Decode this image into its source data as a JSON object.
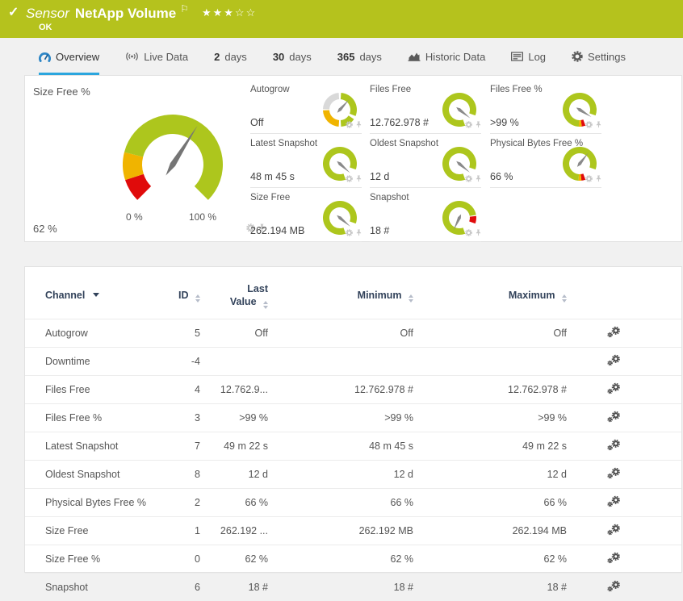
{
  "colors": {
    "green": "#adc61d",
    "yellow": "#f0b400",
    "red": "#e00b0b",
    "gray": "#d9d9d9",
    "header_green": "#b5c21d",
    "accent_blue": "#2ba6de",
    "navy": "#32425a",
    "needle": "#757575",
    "mini_needle": "#8a8a8a"
  },
  "header": {
    "kind_label": "Sensor",
    "title": "NetApp Volume",
    "status": "OK",
    "flag_icon": "flag-icon",
    "stars_filled": 3,
    "stars_total": 5
  },
  "tabs": [
    {
      "label": "Overview",
      "icon": "gauge-icon",
      "active": true
    },
    {
      "label": "Live Data",
      "icon": "live-icon",
      "active": false
    },
    {
      "num": "2",
      "label": "days",
      "active": false
    },
    {
      "num": "30",
      "label": "days",
      "active": false
    },
    {
      "num": "365",
      "label": "days",
      "active": false
    },
    {
      "label": "Historic Data",
      "icon": "chart-icon",
      "active": false
    },
    {
      "label": "Log",
      "icon": "log-icon",
      "active": false
    },
    {
      "label": "Settings",
      "icon": "gear-icon",
      "active": false
    }
  ],
  "overview": {
    "tile_icons": [
      "settings-gear-icon",
      "pin-icon"
    ],
    "main_gauge": {
      "label": "Size Free %",
      "value": "62 %",
      "min_label": "0 %",
      "max_label": "100 %",
      "needle_pct": 62,
      "segments": [
        {
          "from_pct": 0,
          "to_pct": 10,
          "color": "red"
        },
        {
          "from_pct": 10,
          "to_pct": 22,
          "color": "yellow"
        },
        {
          "from_pct": 22,
          "to_pct": 100,
          "color": "green"
        }
      ]
    },
    "mini_gauges": [
      {
        "label": "Autogrow",
        "value": "Off",
        "needle_deg": 42,
        "segments": [
          {
            "from_deg": 272,
            "to_deg": 356,
            "color": "gray"
          },
          {
            "from_deg": 184,
            "to_deg": 268,
            "color": "yellow"
          },
          {
            "from_deg": 4,
            "to_deg": 112,
            "color": "green"
          },
          {
            "from_deg": 124,
            "to_deg": 176,
            "color": "green"
          }
        ]
      },
      {
        "label": "Files Free",
        "value": "12.762.978 #",
        "needle_deg": 128,
        "segments": [
          {
            "from_deg": 160,
            "to_deg": 470,
            "color": "green"
          }
        ]
      },
      {
        "label": "Files Free %",
        "value": ">99 %",
        "needle_deg": 122,
        "segments": [
          {
            "from_deg": 160,
            "to_deg": 173,
            "color": "red"
          },
          {
            "from_deg": 173,
            "to_deg": 183,
            "color": "yellow"
          },
          {
            "from_deg": 183,
            "to_deg": 470,
            "color": "green"
          }
        ]
      },
      {
        "label": "Latest Snapshot",
        "value": "48 m 45 s",
        "needle_deg": 132,
        "segments": [
          {
            "from_deg": 160,
            "to_deg": 470,
            "color": "green"
          }
        ]
      },
      {
        "label": "Oldest Snapshot",
        "value": "12 d",
        "needle_deg": 130,
        "segments": [
          {
            "from_deg": 160,
            "to_deg": 470,
            "color": "green"
          }
        ]
      },
      {
        "label": "Physical Bytes Free %",
        "value": "66 %",
        "needle_deg": 38,
        "segments": [
          {
            "from_deg": 160,
            "to_deg": 174,
            "color": "red"
          },
          {
            "from_deg": 174,
            "to_deg": 184,
            "color": "yellow"
          },
          {
            "from_deg": 184,
            "to_deg": 470,
            "color": "green"
          }
        ]
      },
      {
        "label": "Size Free",
        "value": "262.194 MB",
        "needle_deg": 130,
        "segments": [
          {
            "from_deg": 160,
            "to_deg": 470,
            "color": "green"
          }
        ]
      },
      {
        "label": "Snapshot",
        "value": "18 #",
        "needle_deg": 205,
        "segments": [
          {
            "from_deg": 160,
            "to_deg": 440,
            "color": "green"
          },
          {
            "from_deg": 444,
            "to_deg": 470,
            "color": "red"
          }
        ]
      }
    ]
  },
  "table": {
    "row_icon": "channel-settings-icon",
    "headers": [
      {
        "label": "Channel",
        "sort": "desc"
      },
      {
        "label": "ID",
        "sort": "both"
      },
      {
        "label": "Last Value",
        "sort": "both",
        "wrap": true
      },
      {
        "label": "Minimum",
        "sort": "both"
      },
      {
        "label": "Maximum",
        "sort": "both"
      }
    ],
    "rows": [
      {
        "channel": "Autogrow",
        "id": "5",
        "last": "Off",
        "min": "Off",
        "max": "Off"
      },
      {
        "channel": "Downtime",
        "id": "-4",
        "last": "",
        "min": "",
        "max": ""
      },
      {
        "channel": "Files Free",
        "id": "4",
        "last": "12.762.9...",
        "min": "12.762.978 #",
        "max": "12.762.978 #"
      },
      {
        "channel": "Files Free %",
        "id": "3",
        "last": ">99 %",
        "min": ">99 %",
        "max": ">99 %"
      },
      {
        "channel": "Latest Snapshot",
        "id": "7",
        "last": "49 m 22 s",
        "min": "48 m 45 s",
        "max": "49 m 22 s"
      },
      {
        "channel": "Oldest Snapshot",
        "id": "8",
        "last": "12 d",
        "min": "12 d",
        "max": "12 d"
      },
      {
        "channel": "Physical Bytes Free %",
        "id": "2",
        "last": "66 %",
        "min": "66 %",
        "max": "66 %"
      },
      {
        "channel": "Size Free",
        "id": "1",
        "last": "262.192 ...",
        "min": "262.192 MB",
        "max": "262.194 MB"
      },
      {
        "channel": "Size Free %",
        "id": "0",
        "last": "62 %",
        "min": "62 %",
        "max": "62 %"
      },
      {
        "channel": "Snapshot",
        "id": "6",
        "last": "18 #",
        "min": "18 #",
        "max": "18 #"
      }
    ]
  }
}
